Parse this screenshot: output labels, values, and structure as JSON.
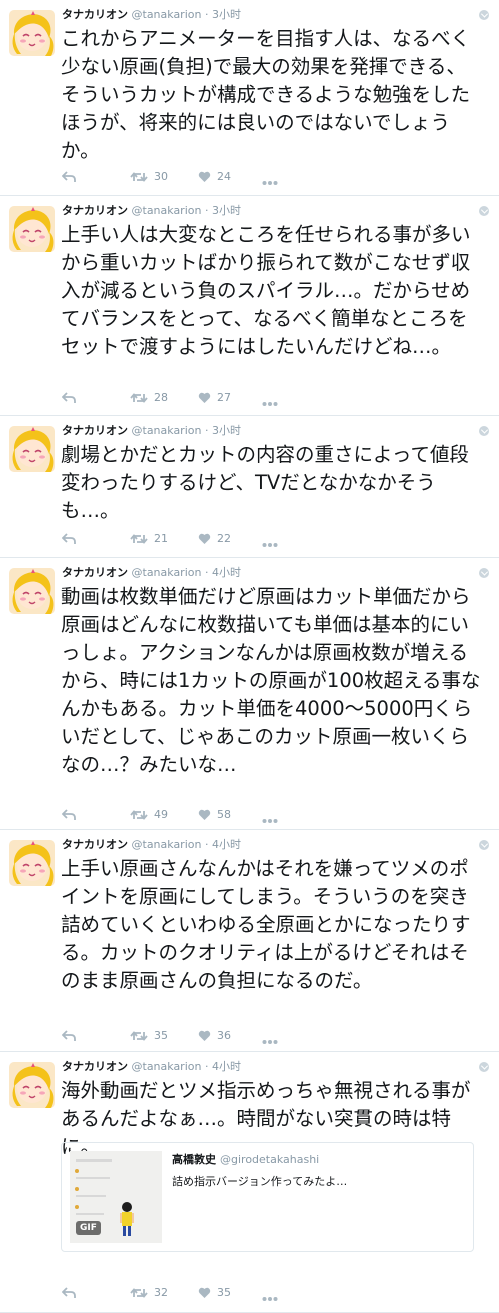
{
  "colors": {
    "icon_gray": "#aab8c2",
    "text_gray": "#8899a6",
    "border": "#e1e8ed",
    "name": "#14171a"
  },
  "tweets": [
    {
      "name": "タナカリオン",
      "handle": "@tanakarion",
      "time": "3小时",
      "text": "これからアニメーターを目指す人は、なるべく少ない原画(負担)で最大の効果を発揮できる、そういうカットが構成できるような勉強をしたほうが、将来的には良いのではないでしょうか。",
      "retweets": "30",
      "likes": "24"
    },
    {
      "name": "タナカリオン",
      "handle": "@tanakarion",
      "time": "3小时",
      "text": "上手い人は大変なところを任せられる事が多いから重いカットばかり振られて数がこなせず収入が減るという負のスパイラル…。だからせめてバランスをとって、なるべく簡単なところをセットで渡すようにはしたいんだけどね…。",
      "retweets": "28",
      "likes": "27"
    },
    {
      "name": "タナカリオン",
      "handle": "@tanakarion",
      "time": "3小时",
      "text": "劇場とかだとカットの内容の重さによって値段変わったりするけど、TVだとなかなかそうも…。",
      "retweets": "21",
      "likes": "22"
    },
    {
      "name": "タナカリオン",
      "handle": "@tanakarion",
      "time": "4小时",
      "text": "動画は枚数単価だけど原画はカット単価だから原画はどんなに枚数描いても単価は基本的にいっしょ。アクションなんかは原画枚数が増えるから、時には1カットの原画が100枚超える事なんかもある。カット単価を4000～5000円くらいだとして、じゃあこのカット原画一枚いくらなの…？みたいな…",
      "retweets": "49",
      "likes": "58"
    },
    {
      "name": "タナカリオン",
      "handle": "@tanakarion",
      "time": "4小时",
      "text": "上手い原画さんなんかはそれを嫌ってツメのポイントを原画にしてしまう。そういうのを突き詰めていくといわゆる全原画とかになったりする。カットのクオリティは上がるけどそれはそのまま原画さんの負担になるのだ。",
      "retweets": "35",
      "likes": "36"
    },
    {
      "name": "タナカリオン",
      "handle": "@tanakarion",
      "time": "4小时",
      "text": "海外動画だとツメ指示めっちゃ無視される事があるんだよなぁ…。時間がない突貫の時は特に。",
      "retweets": "32",
      "likes": "35",
      "quote": {
        "name": "高橋敦史",
        "handle": "@girodetakahashi",
        "text": "詰め指示バージョン作ってみたよ…",
        "badge": "GIF"
      }
    }
  ]
}
